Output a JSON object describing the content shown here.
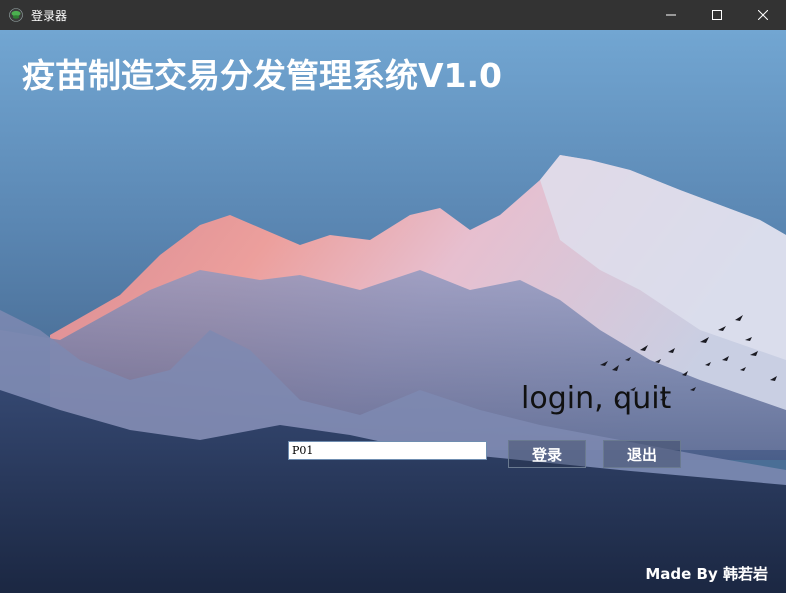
{
  "window": {
    "title": "登录器",
    "icon": "app-leaf-icon",
    "controls": [
      "minimize-icon",
      "maximize-icon",
      "close-icon"
    ]
  },
  "main": {
    "title": "疫苗制造交易分发管理系统V1.0",
    "subtitle": "login, quit"
  },
  "form": {
    "input_value": "P01",
    "login_label": "登录",
    "quit_label": "退出"
  },
  "footer": {
    "credit": "Made By 韩若岩"
  },
  "colors": {
    "titlebar": "#333333",
    "sky_top": "#6fa3cf",
    "sky_mid": "#4f79a3",
    "mountain_glow": "#e89a9e",
    "foreground": "#1f2e4a",
    "text_white": "#ffffff"
  }
}
